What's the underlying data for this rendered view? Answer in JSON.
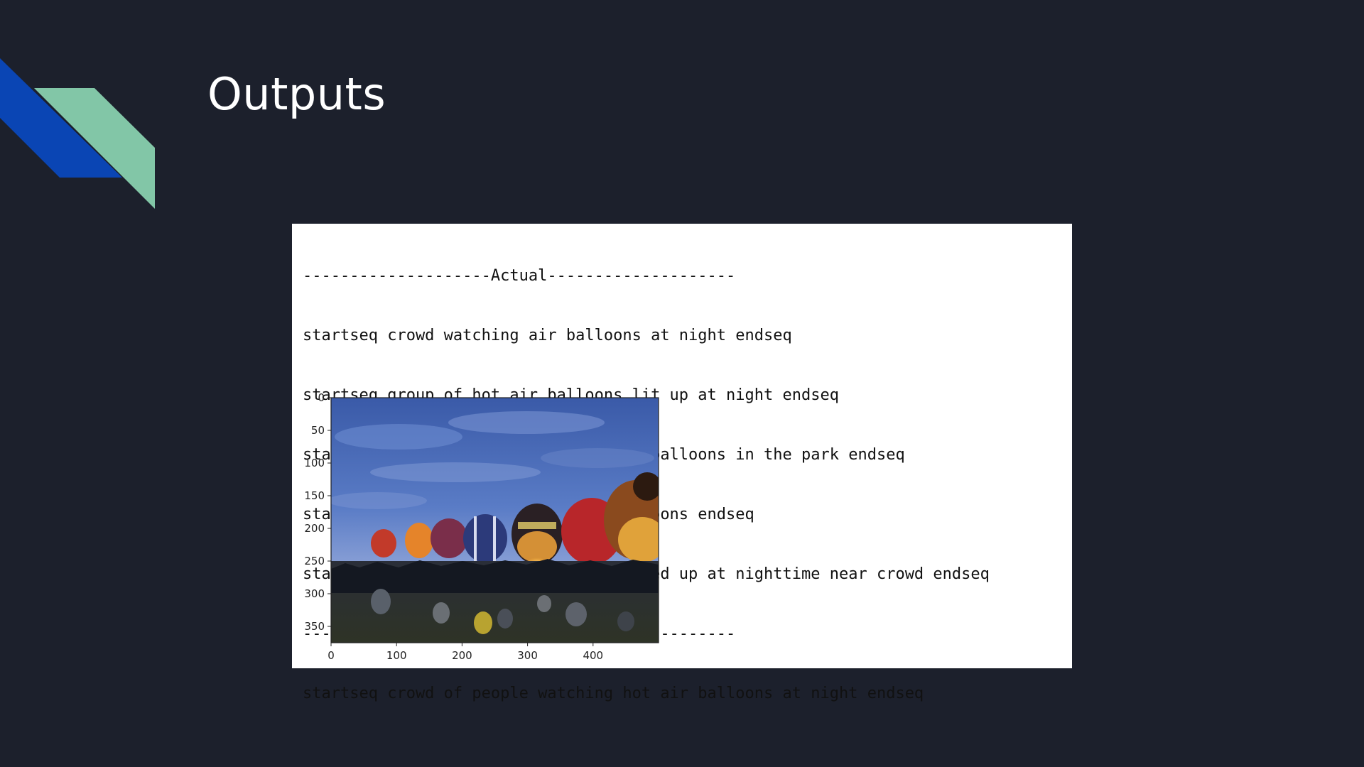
{
  "title": "Outputs",
  "colors": {
    "background": "#1c202c",
    "accent_blue": "#0a45b4",
    "accent_green": "#82c6a7"
  },
  "output": {
    "actual_header": "--------------------Actual--------------------",
    "actual_captions": [
      "startseq crowd watching air balloons at night endseq",
      "startseq group of hot air balloons lit up at night endseq",
      "startseq people are watching hot air balloons in the park endseq",
      "startseq people watching hot air balloons endseq",
      "startseq seven large balloons are lined up at nighttime near crowd endseq"
    ],
    "predicted_header": "-------------------Predicted------------------",
    "predicted_caption": "startseq crowd of people watching hot air balloons at night endseq"
  },
  "chart_data": {
    "type": "image",
    "x_ticks": [
      0,
      100,
      200,
      300,
      400
    ],
    "y_ticks": [
      0,
      50,
      100,
      150,
      200,
      250,
      300,
      350
    ],
    "xlim": [
      0,
      500
    ],
    "ylim": [
      375,
      0
    ],
    "image_content": "hot air balloons glowing at dusk above a crowd"
  }
}
